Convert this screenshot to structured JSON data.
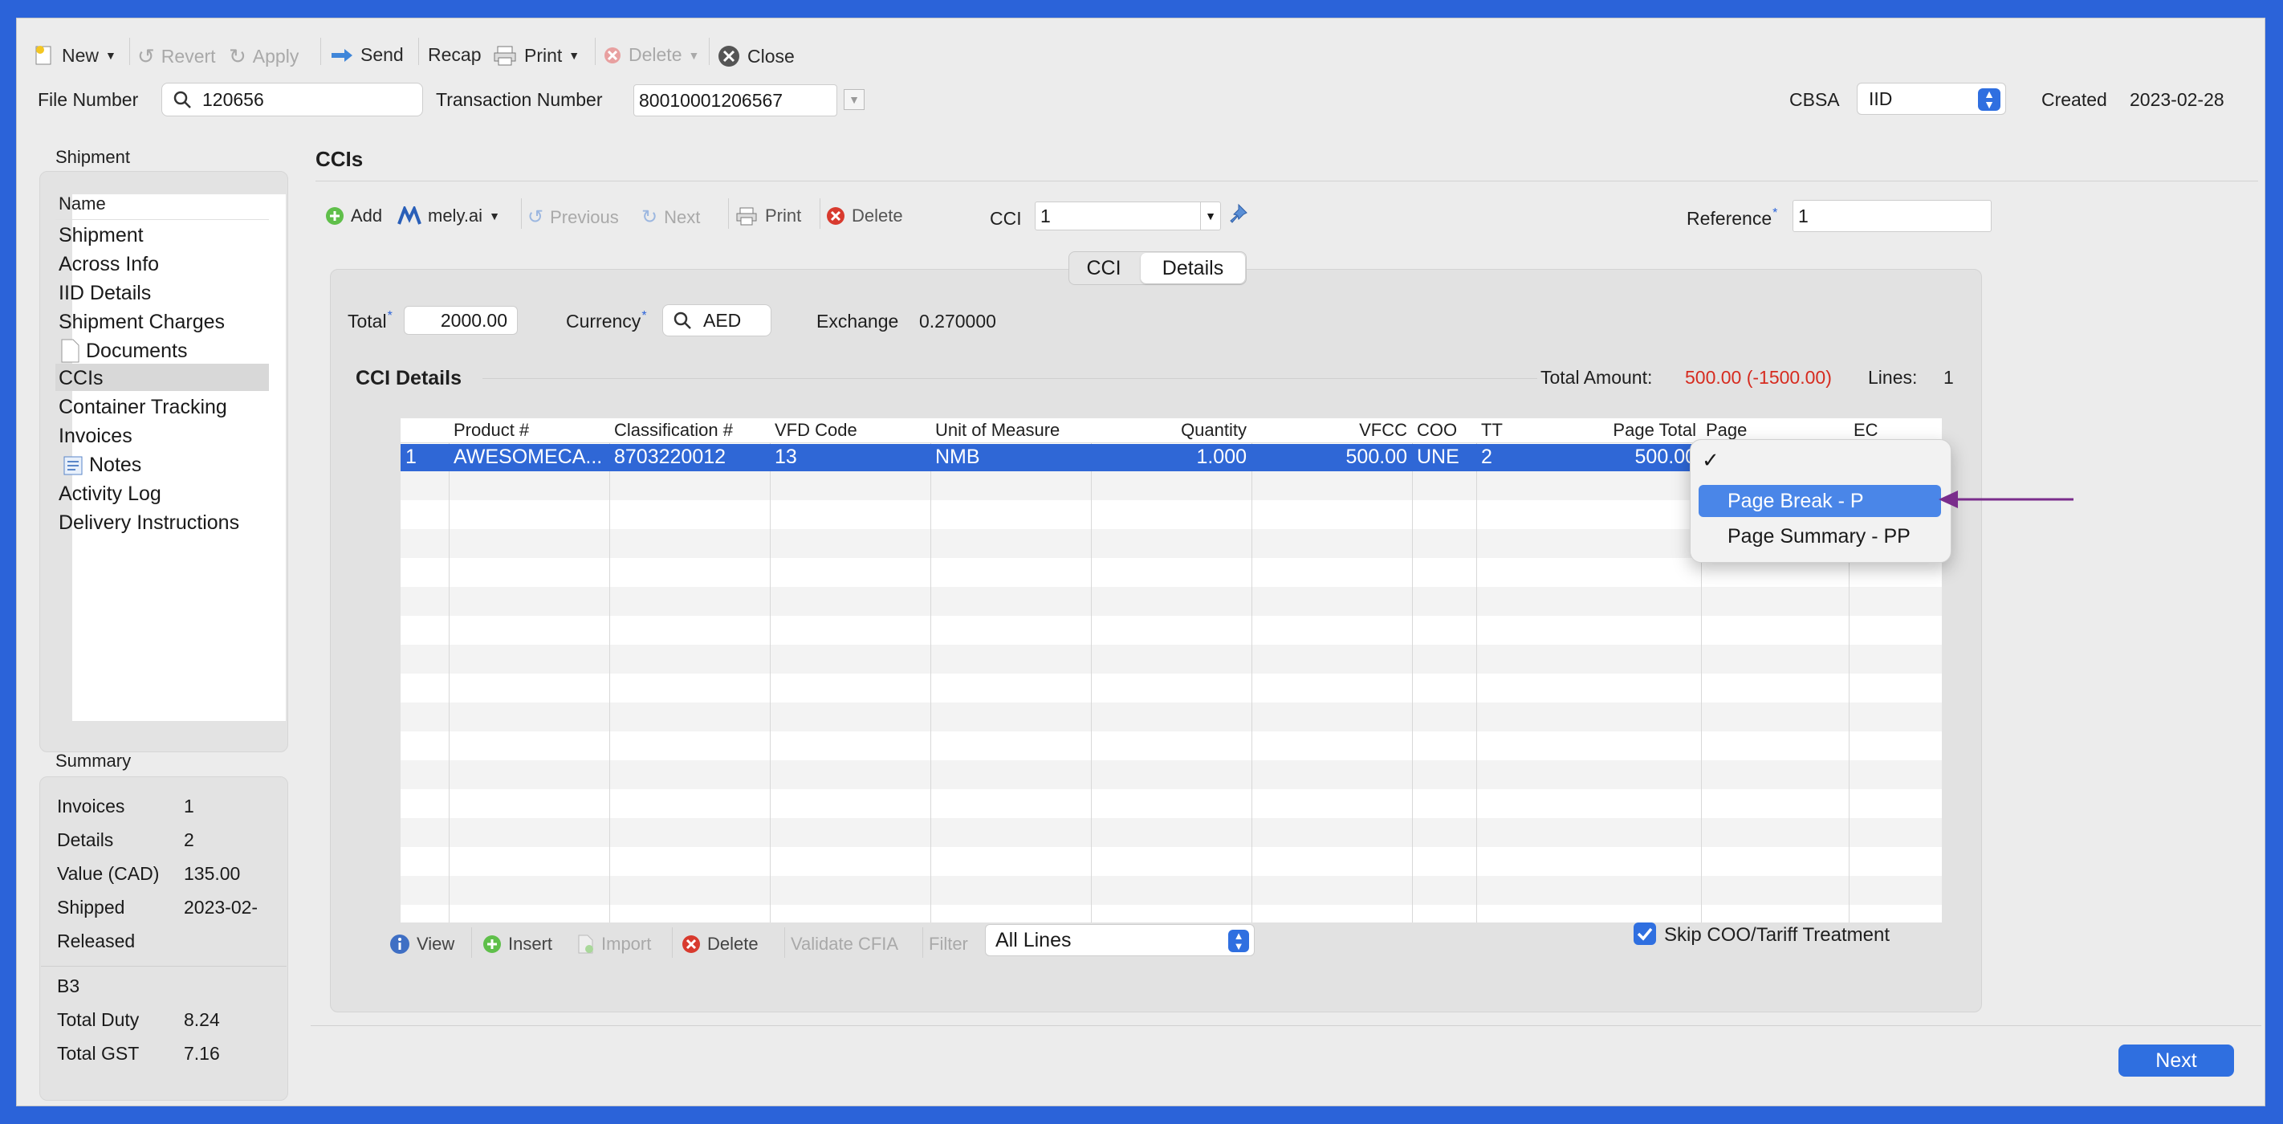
{
  "toolbar": {
    "new": "New",
    "revert": "Revert",
    "apply": "Apply",
    "send": "Send",
    "recap": "Recap",
    "print": "Print",
    "delete": "Delete",
    "close": "Close"
  },
  "header": {
    "file_number_label": "File Number",
    "file_number": "120656",
    "transaction_label": "Transaction Number",
    "transaction_number": "80010001206567",
    "cbsa_label": "CBSA",
    "cbsa_value": "IID",
    "created_label": "Created",
    "created_value": "2023-02-28"
  },
  "sidebar": {
    "title": "Shipment",
    "column": "Name",
    "items": [
      {
        "label": "Shipment"
      },
      {
        "label": "Across Info"
      },
      {
        "label": "IID Details"
      },
      {
        "label": "Shipment Charges"
      },
      {
        "label": "Documents"
      },
      {
        "label": "CCIs"
      },
      {
        "label": "Container Tracking"
      },
      {
        "label": "Invoices"
      },
      {
        "label": "Notes"
      },
      {
        "label": "Activity Log"
      },
      {
        "label": "Delivery Instructions"
      }
    ]
  },
  "summary": {
    "title": "Summary",
    "rows": [
      {
        "label": "Invoices",
        "value": "1"
      },
      {
        "label": "Details",
        "value": "2"
      },
      {
        "label": "Value (CAD)",
        "value": "135.00"
      },
      {
        "label": "Shipped",
        "value": "2023-02-"
      },
      {
        "label": "Released",
        "value": ""
      },
      {
        "label": "B3",
        "value": ""
      },
      {
        "label": "Total Duty",
        "value": "8.24"
      },
      {
        "label": "Total GST",
        "value": "7.16"
      }
    ]
  },
  "ccis": {
    "title": "CCIs",
    "add": "Add",
    "mely": "mely.ai",
    "previous": "Previous",
    "next": "Next",
    "print": "Print",
    "delete": "Delete",
    "cci_label": "CCI",
    "cci_value": "1",
    "reference_label": "Reference",
    "reference_value": "1",
    "tabs": [
      {
        "label": "CCI"
      },
      {
        "label": "Details"
      }
    ],
    "total_label": "Total",
    "total_value": "2000.00",
    "currency_label": "Currency",
    "currency_value": "AED",
    "exchange_label": "Exchange",
    "exchange_value": "0.270000",
    "details_title": "CCI Details",
    "total_amount_label": "Total Amount:",
    "total_amount_value": "500.00 (-1500.00)",
    "lines_label": "Lines:",
    "lines_value": "1"
  },
  "table": {
    "columns": [
      "",
      "Product #",
      "Classification #",
      "VFD Code",
      "Unit of Measure",
      "Quantity",
      "VFCC",
      "COO",
      "TT",
      "Page Total",
      "Page",
      "EC"
    ],
    "rows": [
      [
        "1",
        "AWESOMECA...",
        "8703220012",
        "13",
        "NMB",
        "1.000",
        "500.00",
        "UNE",
        "2",
        "500.00",
        "",
        ""
      ]
    ]
  },
  "dropdown": {
    "check": "✓",
    "options": [
      {
        "label": "Page Break - P"
      },
      {
        "label": "Page Summary - PP"
      }
    ]
  },
  "bottom_bar": {
    "view": "View",
    "insert": "Insert",
    "import": "Import",
    "delete": "Delete",
    "validate": "Validate CFIA",
    "filter_label": "Filter",
    "filter_value": "All Lines",
    "skip_label": "Skip COO/Tariff Treatment"
  },
  "footer": {
    "next": "Next"
  },
  "colors": {
    "accent": "#2b63d9",
    "selection": "#2f67d6",
    "red": "#d62b1f",
    "arrow": "#7a2d8c"
  }
}
